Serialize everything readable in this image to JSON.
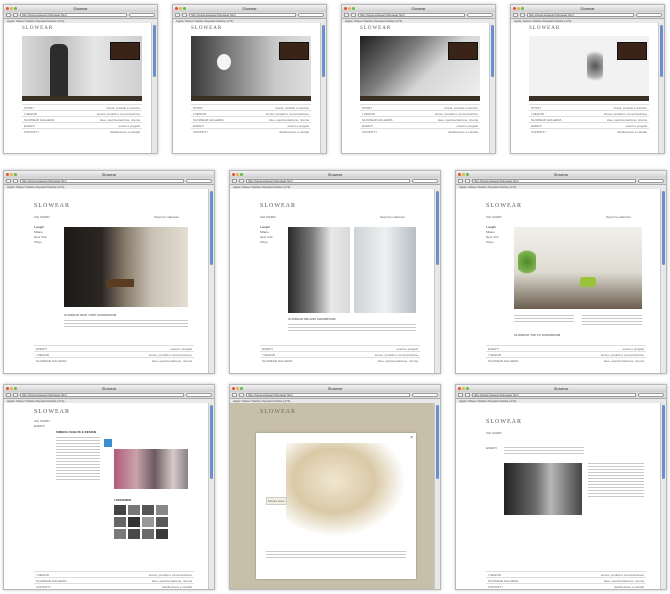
{
  "browser": {
    "title": "Slowear",
    "url": "http://www.slowear.it/slowear.html",
    "bookmarks": "Apple  Yahoo!  Notizie  Popolari  Notizie (171)"
  },
  "site": {
    "logo": "SLOWEAR",
    "nav": [
      "INCOTEX",
      "ZANONE",
      "MONTEDORO",
      "GLANSHIRT"
    ],
    "rows": [
      {
        "left": "STORY",
        "right": "brand, prodotti e ricerche"
      },
      {
        "left": "I NEGOZI",
        "right": "stores, prodotti e comunicazione"
      },
      {
        "left": "SLOWEAR GALLERIA",
        "right": "idee, sperimentazione, ricerca"
      },
      {
        "left": "EVENTI",
        "right": "eventi e progetti"
      },
      {
        "left": "CONTATTI",
        "right": "distribuzione e contatti"
      }
    ],
    "cities": [
      "Milano",
      "New York",
      "Tokyo"
    ],
    "active_city": "Luoghi",
    "captions": {
      "newyork": "SLOWEAR NEW YORK SHOWROOM",
      "milano": "SLOWEAR MILANO SHOWROOM",
      "tokyo": "SLOWEAR TOKYO SHOWROOM"
    },
    "eventi_title": "SIMBOLI SCELTE E DESIGN",
    "designers_label": "I DESIGNER",
    "mostra_label": "Mostra testo",
    "chi_siamo": "CHI SIAMO",
    "top_right": "Scopri le collezioni"
  }
}
